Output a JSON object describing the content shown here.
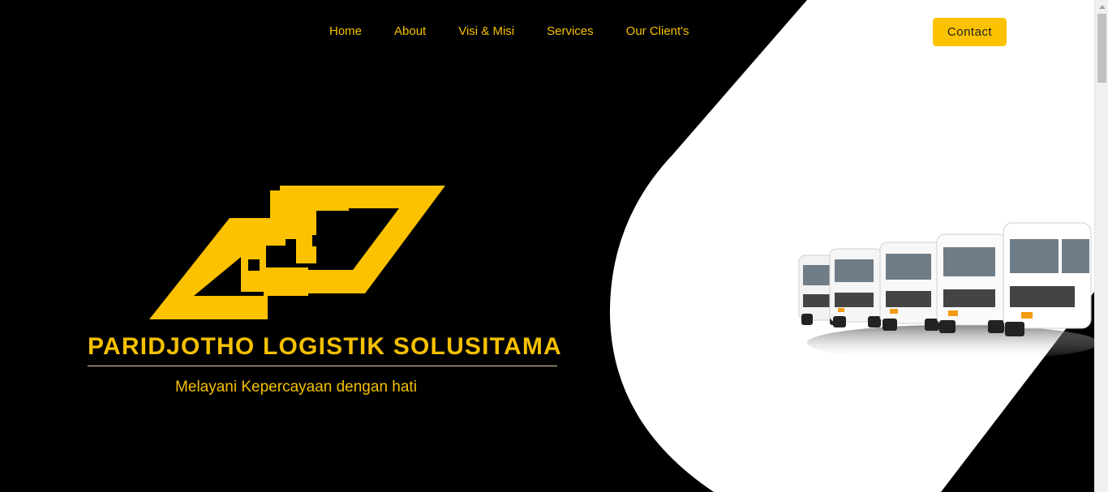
{
  "nav": {
    "items": [
      {
        "label": "Home"
      },
      {
        "label": "About"
      },
      {
        "label": "Visi & Misi"
      },
      {
        "label": "Services"
      },
      {
        "label": "Our Client's"
      }
    ],
    "contact_label": "Contact"
  },
  "hero": {
    "company_name": "PARIDJOTHO LOGISTIK SOLUSITAMA",
    "tagline": "Melayani Kepercayaan dengan hati"
  },
  "colors": {
    "background": "#000000",
    "accent": "#f5c000",
    "button": "#fcc200",
    "shape": "#ffffff"
  },
  "icons": {
    "logo": "company-logo-icon",
    "trucks": "truck-fleet-image"
  }
}
